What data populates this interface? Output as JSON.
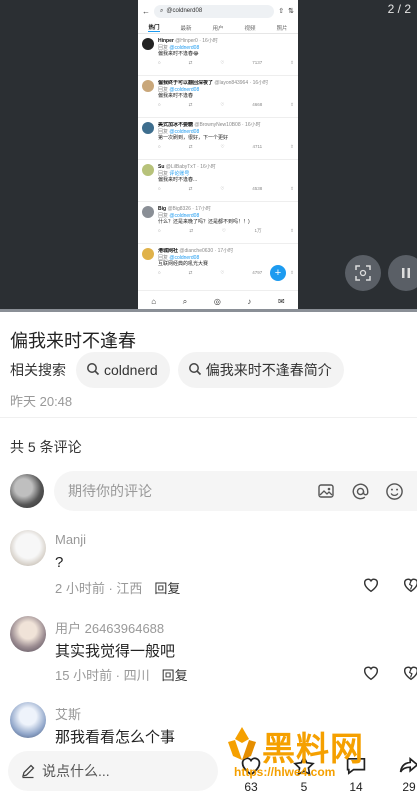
{
  "media": {
    "page_indicator": "2 / 2",
    "search_text": "@coldnerd08",
    "tabs": [
      "热门",
      "最新",
      "用户",
      "视频",
      "照片"
    ],
    "posts": [
      {
        "name": "Hinper",
        "handle": "@Hinper0 · 16小时",
        "reply_to": "@coldnerd08",
        "text": "偏我来时不逢春😂",
        "stats": "7137"
      },
      {
        "name": "偏我终于可以翻回深夜了",
        "handle": "@layon843964 · 16小时",
        "reply_to": "@coldnerd08",
        "text": "偏我来时不逢春",
        "stats": "4668"
      },
      {
        "name": "美式加冰不要糖",
        "handle": "@BrownyNew10B08 · 16小时",
        "reply_to": "@coldnerd08",
        "text": "第一次刷到，很好，下一个更好",
        "stats": "4711"
      },
      {
        "name": "Su",
        "handle": "@LilBabyTxT · 16小时",
        "reply_to": "评论账号",
        "text": "偏我来时不逢春...",
        "stats": "4538"
      },
      {
        "name": "Big",
        "handle": "@Big8326 · 17小时",
        "reply_to": "@coldnerd08",
        "text": "什么？还是来晚了吗？还是都不到吗！！)",
        "stats": "1万"
      },
      {
        "name": "港城网社",
        "handle": "@dianche0630 · 17小时",
        "reply_to": "@coldnerd08",
        "text": "互联网经典的吼光大赛",
        "stats": "4797"
      }
    ],
    "reply_prefix": "回复"
  },
  "post": {
    "title": "偏我来时不逢春",
    "related_label": "相关搜索",
    "related_chips": [
      "coldnerd",
      "偏我来时不逢春简介"
    ],
    "time": "昨天 20:48"
  },
  "comments_header": "共 5 条评论",
  "comment_input": {
    "placeholder": "期待你的评论"
  },
  "comments": [
    {
      "user": "Manji",
      "text": "?",
      "meta": "2 小时前 · 江西",
      "reply": "回复"
    },
    {
      "user": "用户 26463964688",
      "text": "其实我觉得一般吧",
      "meta": "15 小时前 · 四川",
      "reply": "回复"
    },
    {
      "user": "艾斯",
      "text": "那我看看怎么个事",
      "meta": "",
      "reply": ""
    }
  ],
  "bottom": {
    "say_placeholder": "说点什么...",
    "like_count": "63",
    "star_count": "5",
    "comment_count": "14",
    "share_count": "29"
  },
  "watermark": {
    "text": "黑料网",
    "url": "https://hlwe4.com"
  },
  "colors": {
    "accent": "#1d9bf0",
    "watermark": "#f5a000"
  }
}
